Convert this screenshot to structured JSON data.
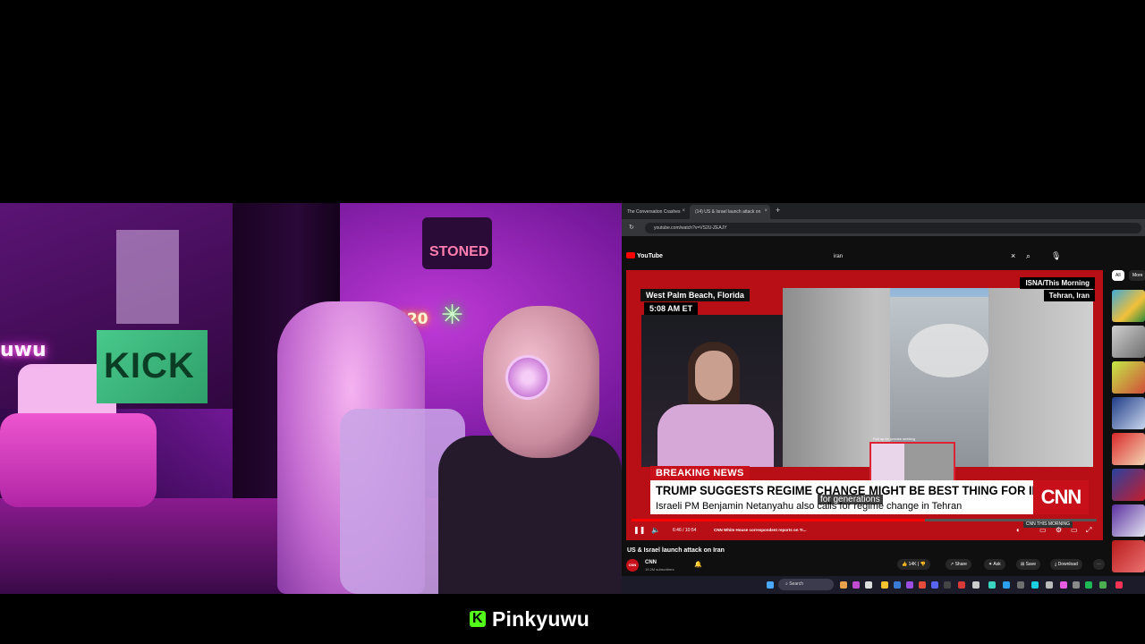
{
  "webcam": {
    "neon_sign_name": "uwu",
    "neon_sign_420": "420",
    "wall_sign": "STONED",
    "green_sign": "KICK"
  },
  "browser": {
    "tabs": [
      {
        "label": "The Conversation Crashes"
      },
      {
        "label": "(14) US & Israel launch attack on"
      }
    ],
    "url": "youtube.com/watch?v=VS2U-ZEAJY"
  },
  "youtube": {
    "logo": "YouTube",
    "search_value": "iran",
    "video": {
      "location_left": "West Palm Beach, Florida",
      "time_left": "5:08 AM ET",
      "location_right_top": "ISNA/This Morning",
      "location_right_bottom": "Tehran, Iran",
      "breaking": "BREAKING NEWS",
      "headline": "TRUMP SUGGESTS REGIME CHANGE MIGHT BE BEST THING FOR IRAN",
      "subline": "Israeli PM Benjamin Netanyahu also calls for regime change in Tehran",
      "network_logo": "CNN",
      "caption": "for generations",
      "pip_caption": "Pull up for precise seeking",
      "progress": 0.63,
      "time": "6:46 / 10:54",
      "chapter": "CNN White House correspondent reports on Tr...",
      "cnn_this": "CNN THIS MORNING"
    },
    "title": "US & Israel launch attack on Iran",
    "channel": {
      "avatar": "CNN",
      "name": "CNN",
      "subscribers": "19.2M subscribers"
    },
    "actions": {
      "likes": "14K",
      "share": "Share",
      "ask": "Ask",
      "save": "Save",
      "download": "Download"
    },
    "chips": [
      "All",
      "More"
    ]
  },
  "taskbar": {
    "search": "Search"
  },
  "footer": {
    "logo_letter": "K",
    "streamer": "Pinkyuwu"
  },
  "colors": {
    "kick_green": "#53fc18",
    "cnn_red": "#c8101a",
    "youtube_red": "#ff0000"
  }
}
